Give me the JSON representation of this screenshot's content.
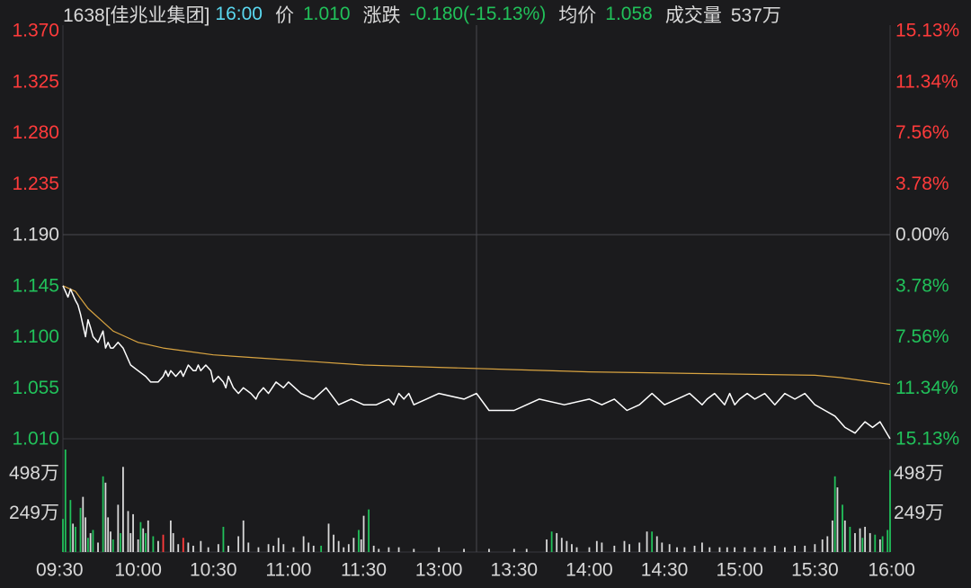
{
  "header": {
    "stock": "1638[佳兆业集团]",
    "time": "16:00",
    "price_label": "价",
    "price": "1.010",
    "change_label": "涨跌",
    "change": "-0.180(-15.13%)",
    "avg_label": "均价",
    "avg": "1.058",
    "volume_label": "成交量",
    "volume": "537万"
  },
  "colors": {
    "background": "#1b1b1d",
    "up": "#ff3b3b",
    "down": "#21c15a",
    "neutral": "#d8d8d8",
    "time": "#5ad8f0",
    "price_line": "#ffffff",
    "avg_line": "#d9a441",
    "grid": "#333338",
    "axis": "#3a3a3e"
  },
  "chart_data": {
    "type": "line",
    "prev_close": 1.19,
    "ylim": [
      1.01,
      1.37
    ],
    "y_ticks": [
      {
        "value": 1.37,
        "label": "1.370",
        "pct": "15.13%"
      },
      {
        "value": 1.325,
        "label": "1.325",
        "pct": "11.34%"
      },
      {
        "value": 1.28,
        "label": "1.280",
        "pct": "7.56%"
      },
      {
        "value": 1.235,
        "label": "1.235",
        "pct": "3.78%"
      },
      {
        "value": 1.19,
        "label": "1.190",
        "pct": "0.00%"
      },
      {
        "value": 1.145,
        "label": "1.145",
        "pct": "3.78%"
      },
      {
        "value": 1.1,
        "label": "1.100",
        "pct": "7.56%"
      },
      {
        "value": 1.055,
        "label": "1.055",
        "pct": "11.34%"
      },
      {
        "value": 1.01,
        "label": "1.010",
        "pct": "15.13%"
      }
    ],
    "x_ticks": [
      "09:30",
      "10:00",
      "10:30",
      "11:00",
      "11:30",
      "13:00",
      "13:30",
      "14:00",
      "14:30",
      "15:00",
      "15:30",
      "16:00"
    ],
    "price_series": {
      "t": [
        0,
        2,
        3,
        5,
        6,
        7,
        8,
        9,
        10,
        11,
        12,
        14,
        16,
        17,
        18,
        19,
        20,
        22,
        24,
        27,
        30,
        33,
        35,
        36,
        38,
        40,
        41,
        42,
        43,
        45,
        47,
        48,
        50,
        52,
        53,
        54,
        55,
        57,
        59,
        60,
        62,
        64,
        65,
        66,
        67,
        68,
        70,
        72,
        75,
        77,
        78,
        80,
        82,
        85,
        88,
        90,
        95,
        100,
        105,
        110,
        115,
        120,
        125,
        130,
        132,
        134,
        136,
        138,
        140,
        145,
        150,
        160,
        165,
        170,
        180,
        185,
        190,
        200,
        210,
        215,
        220,
        225,
        230,
        235,
        240,
        245,
        250,
        255,
        257,
        260,
        262,
        264,
        266,
        268,
        270,
        273,
        276,
        280,
        284,
        288,
        292,
        296,
        300,
        304,
        308,
        312,
        316,
        318,
        320,
        323,
        326,
        330
      ],
      "v": [
        1.145,
        1.135,
        1.142,
        1.132,
        1.128,
        1.12,
        1.11,
        1.1,
        1.115,
        1.108,
        1.1,
        1.095,
        1.105,
        1.09,
        1.095,
        1.09,
        1.09,
        1.095,
        1.09,
        1.075,
        1.07,
        1.065,
        1.06,
        1.06,
        1.06,
        1.065,
        1.07,
        1.065,
        1.07,
        1.065,
        1.07,
        1.065,
        1.075,
        1.07,
        1.07,
        1.075,
        1.07,
        1.075,
        1.07,
        1.06,
        1.065,
        1.06,
        1.055,
        1.065,
        1.06,
        1.055,
        1.05,
        1.055,
        1.05,
        1.045,
        1.05,
        1.055,
        1.05,
        1.06,
        1.055,
        1.06,
        1.05,
        1.045,
        1.055,
        1.04,
        1.045,
        1.04,
        1.04,
        1.045,
        1.04,
        1.05,
        1.045,
        1.05,
        1.04,
        1.045,
        1.05,
        1.045,
        1.05,
        1.035,
        1.035,
        1.04,
        1.045,
        1.04,
        1.045,
        1.04,
        1.045,
        1.035,
        1.04,
        1.05,
        1.04,
        1.045,
        1.05,
        1.04,
        1.045,
        1.05,
        1.045,
        1.04,
        1.05,
        1.04,
        1.045,
        1.05,
        1.045,
        1.05,
        1.04,
        1.05,
        1.045,
        1.05,
        1.04,
        1.035,
        1.03,
        1.02,
        1.015,
        1.02,
        1.025,
        1.02,
        1.025,
        1.01
      ]
    },
    "avg_series": {
      "t": [
        0,
        5,
        10,
        15,
        20,
        25,
        30,
        40,
        50,
        60,
        80,
        100,
        120,
        150,
        180,
        210,
        240,
        270,
        300,
        310,
        330
      ],
      "v": [
        1.145,
        1.14,
        1.125,
        1.115,
        1.105,
        1.1,
        1.095,
        1.09,
        1.087,
        1.084,
        1.081,
        1.078,
        1.075,
        1.073,
        1.071,
        1.069,
        1.068,
        1.067,
        1.066,
        1.064,
        1.058
      ]
    },
    "volume": {
      "ylim": [
        0,
        650
      ],
      "y_ticks": [
        {
          "value": 498,
          "label": "498万"
        },
        {
          "value": 249,
          "label": "249万"
        }
      ],
      "bars": [
        {
          "t": 0,
          "v": 210,
          "c": "g"
        },
        {
          "t": 1,
          "v": 650,
          "c": "g"
        },
        {
          "t": 3,
          "v": 330,
          "c": "g"
        },
        {
          "t": 4,
          "v": 180,
          "c": "w"
        },
        {
          "t": 5,
          "v": 160,
          "c": "g"
        },
        {
          "t": 7,
          "v": 280,
          "c": "g"
        },
        {
          "t": 8,
          "v": 350,
          "c": "w"
        },
        {
          "t": 9,
          "v": 220,
          "c": "w"
        },
        {
          "t": 10,
          "v": 90,
          "c": "g"
        },
        {
          "t": 11,
          "v": 120,
          "c": "w"
        },
        {
          "t": 12,
          "v": 140,
          "c": "g"
        },
        {
          "t": 14,
          "v": 60,
          "c": "w"
        },
        {
          "t": 16,
          "v": 480,
          "c": "g"
        },
        {
          "t": 17,
          "v": 440,
          "c": "w"
        },
        {
          "t": 18,
          "v": 220,
          "c": "w"
        },
        {
          "t": 19,
          "v": 130,
          "c": "w"
        },
        {
          "t": 20,
          "v": 80,
          "c": "g"
        },
        {
          "t": 22,
          "v": 300,
          "c": "w"
        },
        {
          "t": 23,
          "v": 120,
          "c": "g"
        },
        {
          "t": 24,
          "v": 540,
          "c": "w"
        },
        {
          "t": 26,
          "v": 260,
          "c": "w"
        },
        {
          "t": 27,
          "v": 120,
          "c": "w"
        },
        {
          "t": 28,
          "v": 240,
          "c": "w"
        },
        {
          "t": 30,
          "v": 80,
          "c": "w"
        },
        {
          "t": 31,
          "v": 190,
          "c": "g"
        },
        {
          "t": 32,
          "v": 150,
          "c": "w"
        },
        {
          "t": 33,
          "v": 120,
          "c": "g"
        },
        {
          "t": 34,
          "v": 200,
          "c": "w"
        },
        {
          "t": 36,
          "v": 100,
          "c": "g"
        },
        {
          "t": 38,
          "v": 70,
          "c": "w"
        },
        {
          "t": 40,
          "v": 110,
          "c": "r"
        },
        {
          "t": 43,
          "v": 200,
          "c": "w"
        },
        {
          "t": 44,
          "v": 120,
          "c": "w"
        },
        {
          "t": 46,
          "v": 50,
          "c": "w"
        },
        {
          "t": 48,
          "v": 90,
          "c": "r"
        },
        {
          "t": 50,
          "v": 60,
          "c": "w"
        },
        {
          "t": 52,
          "v": 40,
          "c": "w"
        },
        {
          "t": 55,
          "v": 70,
          "c": "w"
        },
        {
          "t": 58,
          "v": 30,
          "c": "w"
        },
        {
          "t": 62,
          "v": 50,
          "c": "w"
        },
        {
          "t": 64,
          "v": 160,
          "c": "g"
        },
        {
          "t": 66,
          "v": 40,
          "c": "w"
        },
        {
          "t": 70,
          "v": 100,
          "c": "w"
        },
        {
          "t": 72,
          "v": 200,
          "c": "w"
        },
        {
          "t": 74,
          "v": 60,
          "c": "w"
        },
        {
          "t": 78,
          "v": 30,
          "c": "w"
        },
        {
          "t": 82,
          "v": 50,
          "c": "w"
        },
        {
          "t": 84,
          "v": 40,
          "c": "w"
        },
        {
          "t": 86,
          "v": 90,
          "c": "w"
        },
        {
          "t": 88,
          "v": 50,
          "c": "w"
        },
        {
          "t": 92,
          "v": 30,
          "c": "w"
        },
        {
          "t": 96,
          "v": 100,
          "c": "w"
        },
        {
          "t": 98,
          "v": 60,
          "c": "w"
        },
        {
          "t": 100,
          "v": 40,
          "c": "w"
        },
        {
          "t": 103,
          "v": 40,
          "c": "g"
        },
        {
          "t": 106,
          "v": 180,
          "c": "w"
        },
        {
          "t": 108,
          "v": 110,
          "c": "w"
        },
        {
          "t": 110,
          "v": 70,
          "c": "w"
        },
        {
          "t": 112,
          "v": 30,
          "c": "w"
        },
        {
          "t": 114,
          "v": 50,
          "c": "w"
        },
        {
          "t": 116,
          "v": 90,
          "c": "w"
        },
        {
          "t": 118,
          "v": 140,
          "c": "g"
        },
        {
          "t": 119,
          "v": 80,
          "c": "w"
        },
        {
          "t": 120,
          "v": 230,
          "c": "w"
        },
        {
          "t": 122,
          "v": 270,
          "c": "g"
        },
        {
          "t": 124,
          "v": 40,
          "c": "w"
        },
        {
          "t": 126,
          "v": 20,
          "c": "w"
        },
        {
          "t": 130,
          "v": 30,
          "c": "w"
        },
        {
          "t": 134,
          "v": 30,
          "c": "w"
        },
        {
          "t": 140,
          "v": 20,
          "c": "w"
        },
        {
          "t": 150,
          "v": 30,
          "c": "w"
        },
        {
          "t": 160,
          "v": 20,
          "c": "w"
        },
        {
          "t": 170,
          "v": 20,
          "c": "w"
        },
        {
          "t": 180,
          "v": 20,
          "c": "w"
        },
        {
          "t": 185,
          "v": 20,
          "c": "w"
        },
        {
          "t": 193,
          "v": 80,
          "c": "w"
        },
        {
          "t": 195,
          "v": 130,
          "c": "g"
        },
        {
          "t": 197,
          "v": 120,
          "c": "w"
        },
        {
          "t": 199,
          "v": 90,
          "c": "w"
        },
        {
          "t": 201,
          "v": 70,
          "c": "w"
        },
        {
          "t": 203,
          "v": 50,
          "c": "w"
        },
        {
          "t": 205,
          "v": 30,
          "c": "w"
        },
        {
          "t": 210,
          "v": 30,
          "c": "w"
        },
        {
          "t": 213,
          "v": 70,
          "c": "w"
        },
        {
          "t": 215,
          "v": 60,
          "c": "w"
        },
        {
          "t": 220,
          "v": 40,
          "c": "w"
        },
        {
          "t": 224,
          "v": 70,
          "c": "w"
        },
        {
          "t": 226,
          "v": 50,
          "c": "w"
        },
        {
          "t": 230,
          "v": 60,
          "c": "w"
        },
        {
          "t": 233,
          "v": 130,
          "c": "w"
        },
        {
          "t": 235,
          "v": 130,
          "c": "g"
        },
        {
          "t": 237,
          "v": 100,
          "c": "w"
        },
        {
          "t": 239,
          "v": 60,
          "c": "w"
        },
        {
          "t": 242,
          "v": 50,
          "c": "w"
        },
        {
          "t": 245,
          "v": 30,
          "c": "w"
        },
        {
          "t": 248,
          "v": 30,
          "c": "w"
        },
        {
          "t": 252,
          "v": 40,
          "c": "w"
        },
        {
          "t": 255,
          "v": 60,
          "c": "w"
        },
        {
          "t": 258,
          "v": 30,
          "c": "w"
        },
        {
          "t": 262,
          "v": 30,
          "c": "w"
        },
        {
          "t": 265,
          "v": 30,
          "c": "w"
        },
        {
          "t": 268,
          "v": 30,
          "c": "w"
        },
        {
          "t": 272,
          "v": 30,
          "c": "w"
        },
        {
          "t": 276,
          "v": 30,
          "c": "w"
        },
        {
          "t": 280,
          "v": 30,
          "c": "w"
        },
        {
          "t": 284,
          "v": 40,
          "c": "w"
        },
        {
          "t": 288,
          "v": 30,
          "c": "w"
        },
        {
          "t": 292,
          "v": 40,
          "c": "w"
        },
        {
          "t": 296,
          "v": 40,
          "c": "w"
        },
        {
          "t": 300,
          "v": 50,
          "c": "w"
        },
        {
          "t": 303,
          "v": 80,
          "c": "w"
        },
        {
          "t": 305,
          "v": 100,
          "c": "w"
        },
        {
          "t": 307,
          "v": 200,
          "c": "w"
        },
        {
          "t": 308,
          "v": 480,
          "c": "g"
        },
        {
          "t": 309,
          "v": 410,
          "c": "w"
        },
        {
          "t": 311,
          "v": 300,
          "c": "g"
        },
        {
          "t": 312,
          "v": 200,
          "c": "w"
        },
        {
          "t": 314,
          "v": 160,
          "c": "g"
        },
        {
          "t": 316,
          "v": 120,
          "c": "w"
        },
        {
          "t": 318,
          "v": 150,
          "c": "w"
        },
        {
          "t": 319,
          "v": 90,
          "c": "g"
        },
        {
          "t": 320,
          "v": 160,
          "c": "w"
        },
        {
          "t": 322,
          "v": 120,
          "c": "w"
        },
        {
          "t": 324,
          "v": 110,
          "c": "g"
        },
        {
          "t": 326,
          "v": 80,
          "c": "w"
        },
        {
          "t": 327,
          "v": 100,
          "c": "g"
        },
        {
          "t": 329,
          "v": 140,
          "c": "g"
        },
        {
          "t": 330,
          "v": 520,
          "c": "g"
        }
      ]
    }
  }
}
